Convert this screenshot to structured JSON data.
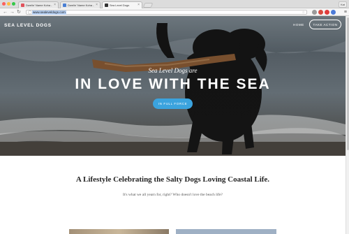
{
  "browser": {
    "tabs": [
      {
        "label": "Dwelin' Name Koha - Smi",
        "icon_color": "#e0525c",
        "active": false
      },
      {
        "label": "Dwelin' Name Koha - Shi",
        "icon_color": "#4a7fd4",
        "active": false
      },
      {
        "label": "Sea Level Dogs",
        "icon_color": "#333333",
        "active": true
      }
    ],
    "user_label": "Kat",
    "url": "www.sealeveldogs.com",
    "extension_colors": [
      "#9a9a9a",
      "#d84a3f",
      "#e03b3b",
      "#4c7bd8",
      "#3a3a3a"
    ]
  },
  "site": {
    "logo": "SEA LEVEL DOGS",
    "nav": {
      "home": "HOME",
      "cta": "TAKE ACTION"
    },
    "hero": {
      "kicker": "Sea Level Dogs are",
      "title": "IN LOVE WITH THE SEA",
      "button": "IN FULL FORCE"
    },
    "content": {
      "title": "A Lifestyle Celebrating the Salty Dogs Loving Coastal Life.",
      "subtitle": "It's what we all yearn for, right? Who doesn't love the beach life?"
    }
  },
  "colors": {
    "accent": "#3ba3de"
  }
}
